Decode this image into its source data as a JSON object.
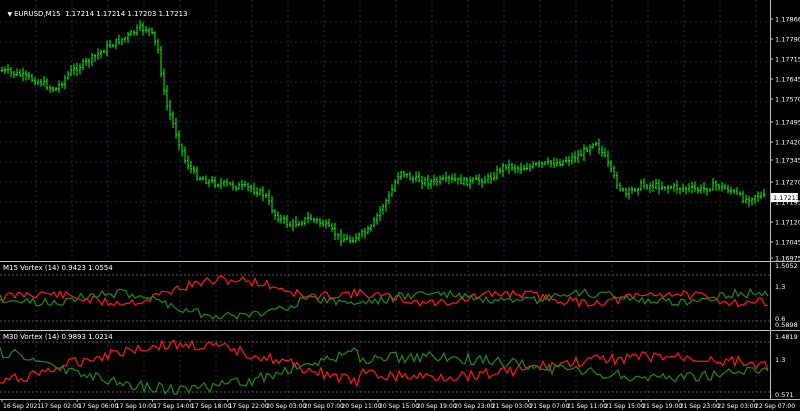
{
  "main": {
    "title": "EURUSD,M15",
    "ohlc": "1.17214 1.17214 1.17203 1.17213",
    "price_ticks": [
      "1.17866",
      "1.17790",
      "1.17715",
      "1.17645",
      "1.17570",
      "1.17495",
      "1.17420",
      "1.17345",
      "1.17270",
      "1.17195",
      "1.17120",
      "1.17045",
      "1.16975"
    ],
    "current_price": "1.17213"
  },
  "m15_vortex": {
    "label": "M15 Vortex (14) 0.9423 1.0554",
    "ticks": [
      "1.5052",
      "1.3",
      "0.6",
      "0.5898"
    ]
  },
  "m30_vortex": {
    "label": "M30 Vortex (14) 0.9893 1.0214",
    "ticks": [
      "1.4819",
      "1.3",
      "0.571"
    ]
  },
  "time_axis": [
    "16 Sep 2021",
    "17 Sep 02:00",
    "17 Sep 06:00",
    "17 Sep 10:00",
    "17 Sep 14:00",
    "17 Sep 18:00",
    "17 Sep 22:00",
    "20 Sep 03:00",
    "20 Sep 07:00",
    "20 Sep 11:00",
    "20 Sep 15:00",
    "20 Sep 19:00",
    "20 Sep 23:00",
    "21 Sep 03:00",
    "21 Sep 07:00",
    "21 Sep 11:00",
    "21 Sep 15:00",
    "21 Sep 19:00",
    "21 Sep 23:00",
    "22 Sep 03:00",
    "22 Sep 07:00"
  ],
  "colors": {
    "background": "#000000",
    "candle_up": "#00ff00",
    "vi_plus": "#1f8a1f",
    "vi_minus": "#ff1a1a",
    "grid": "#3a4a6a",
    "axis": "#c0c0c0"
  }
}
